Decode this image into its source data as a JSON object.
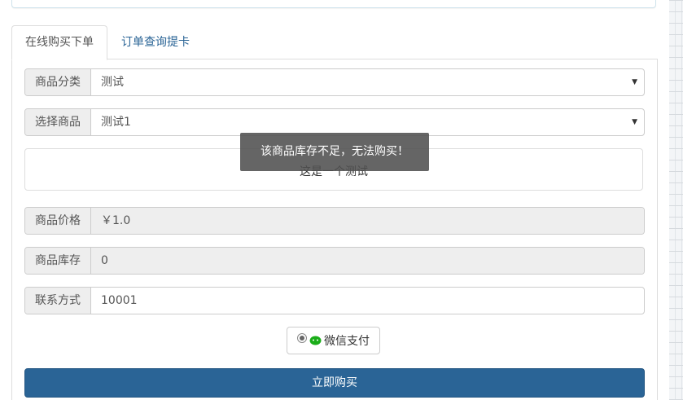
{
  "tabs": [
    {
      "label": "在线购买下单",
      "active": true
    },
    {
      "label": "订单查询提卡",
      "active": false
    }
  ],
  "form": {
    "category": {
      "label": "商品分类",
      "value": "测试"
    },
    "product": {
      "label": "选择商品",
      "value": "测试1"
    },
    "description": "这是一个测试",
    "price": {
      "label": "商品价格",
      "value": "￥1.0"
    },
    "stock": {
      "label": "商品库存",
      "value": "0"
    },
    "contact": {
      "label": "联系方式",
      "value": "10001"
    }
  },
  "payment": {
    "option_label": "微信支付",
    "icon": "wechat-icon",
    "selected": true
  },
  "buy_button": "立即购买",
  "toast": "该商品库存不足，无法购买！",
  "colors": {
    "primary": "#2a6496",
    "toast_bg": "#505050",
    "addon_bg": "#eeeeee",
    "wechat_green": "#1aad19"
  }
}
